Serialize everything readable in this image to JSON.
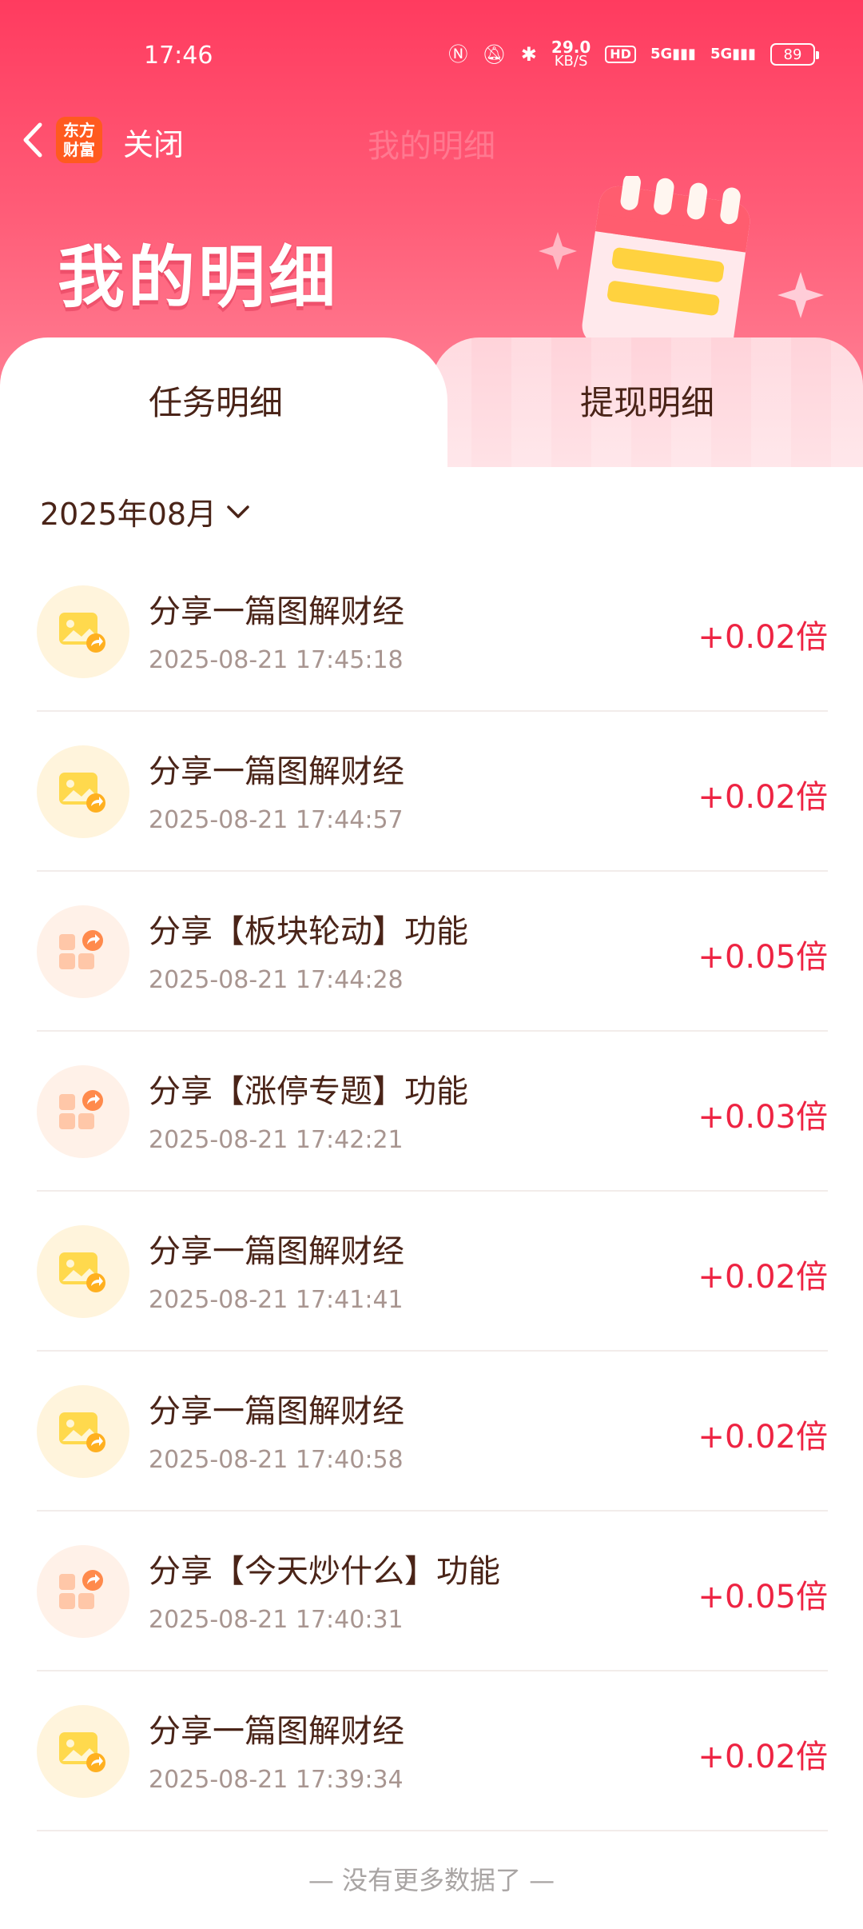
{
  "status_bar": {
    "time": "17:46",
    "speed_value": "29.0",
    "speed_unit": "KB/S",
    "hd": "HD",
    "signal_1": "5G",
    "signal_2": "5G",
    "battery": "89"
  },
  "nav": {
    "app_logo_text": "东方财富",
    "close_label": "关闭",
    "title": "我的明细"
  },
  "banner": {
    "title": "我的明细"
  },
  "tabs": [
    {
      "label": "任务明细",
      "active": true
    },
    {
      "label": "提现明细",
      "active": false
    }
  ],
  "month_selector": {
    "label": "2025年08月"
  },
  "records": [
    {
      "title": "分享一篇图解财经",
      "time": "2025-08-21 17:45:18",
      "value": "+0.02倍",
      "icon": "image-share-icon"
    },
    {
      "title": "分享一篇图解财经",
      "time": "2025-08-21 17:44:57",
      "value": "+0.02倍",
      "icon": "image-share-icon"
    },
    {
      "title": "分享【板块轮动】功能",
      "time": "2025-08-21 17:44:28",
      "value": "+0.05倍",
      "icon": "grid-share-icon"
    },
    {
      "title": "分享【涨停专题】功能",
      "time": "2025-08-21 17:42:21",
      "value": "+0.03倍",
      "icon": "grid-share-icon"
    },
    {
      "title": "分享一篇图解财经",
      "time": "2025-08-21 17:41:41",
      "value": "+0.02倍",
      "icon": "image-share-icon"
    },
    {
      "title": "分享一篇图解财经",
      "time": "2025-08-21 17:40:58",
      "value": "+0.02倍",
      "icon": "image-share-icon"
    },
    {
      "title": "分享【今天炒什么】功能",
      "time": "2025-08-21 17:40:31",
      "value": "+0.05倍",
      "icon": "grid-share-icon"
    },
    {
      "title": "分享一篇图解财经",
      "time": "2025-08-21 17:39:34",
      "value": "+0.02倍",
      "icon": "image-share-icon"
    }
  ],
  "footer": {
    "note": "— 没有更多数据了 —"
  },
  "colors": {
    "header_top": "#ff3b5f",
    "accent_red": "#ee2443",
    "text_brown": "#4a2418"
  }
}
